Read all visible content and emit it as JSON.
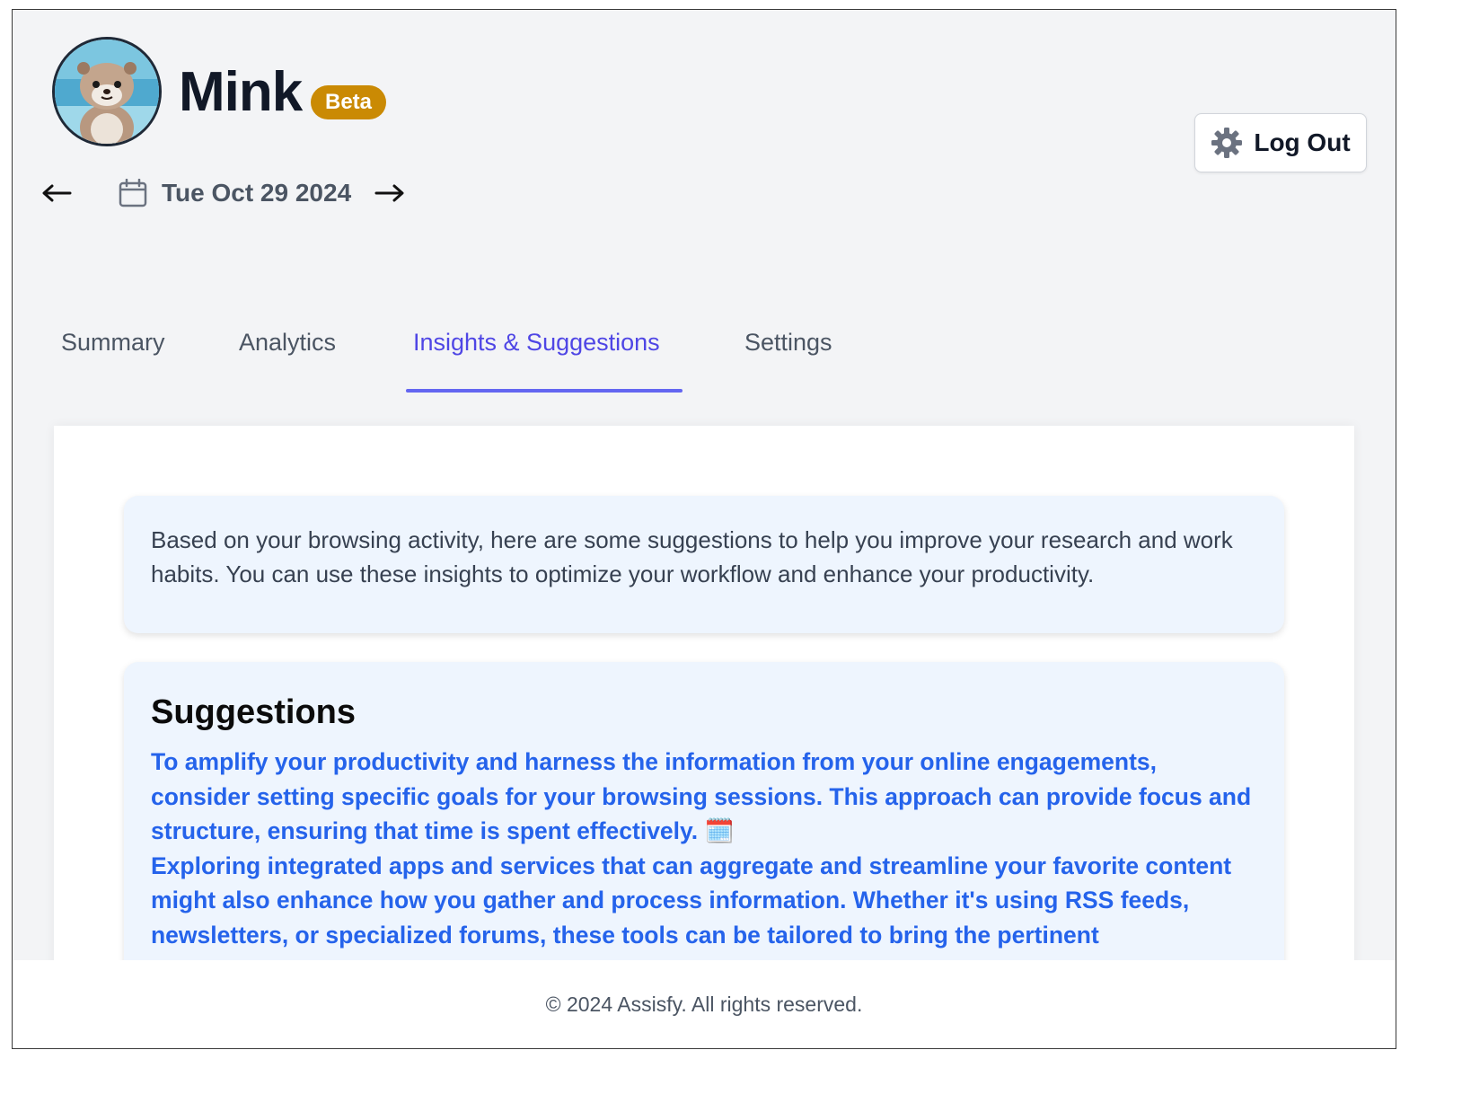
{
  "app": {
    "name": "Mink",
    "badge": "Beta"
  },
  "date_nav": {
    "date": "Tue Oct 29 2024",
    "prev_icon": "arrow-left-icon",
    "next_icon": "arrow-right-icon",
    "calendar_icon": "calendar-icon"
  },
  "header": {
    "logout_label": "Log Out",
    "logout_icon": "gear-icon"
  },
  "tabs": [
    {
      "label": "Summary",
      "active": false
    },
    {
      "label": "Analytics",
      "active": false
    },
    {
      "label": "Insights & Suggestions",
      "active": true
    },
    {
      "label": "Settings",
      "active": false
    }
  ],
  "intro": {
    "text": "Based on your browsing activity, here are some suggestions to help you improve your research and work habits. You can use these insights to optimize your workflow and enhance your productivity."
  },
  "suggestions": {
    "title": "Suggestions",
    "items": [
      "To amplify your productivity and harness the information from your online engagements, consider setting specific goals for your browsing sessions. This approach can provide focus and structure, ensuring that time is spent effectively. 🗓️",
      "Exploring integrated apps and services that can aggregate and streamline your favorite content might also enhance how you gather and process information. Whether it's using RSS feeds, newsletters, or specialized forums, these tools can be tailored to bring the pertinent"
    ]
  },
  "footer": {
    "text": "© 2024 Assisfy. All rights reserved."
  },
  "colors": {
    "accent": "#4f46e5",
    "badge": "#ca8a04",
    "link_text": "#2563eb",
    "card_bg": "#eef5fe",
    "page_bg": "#f3f4f6"
  }
}
